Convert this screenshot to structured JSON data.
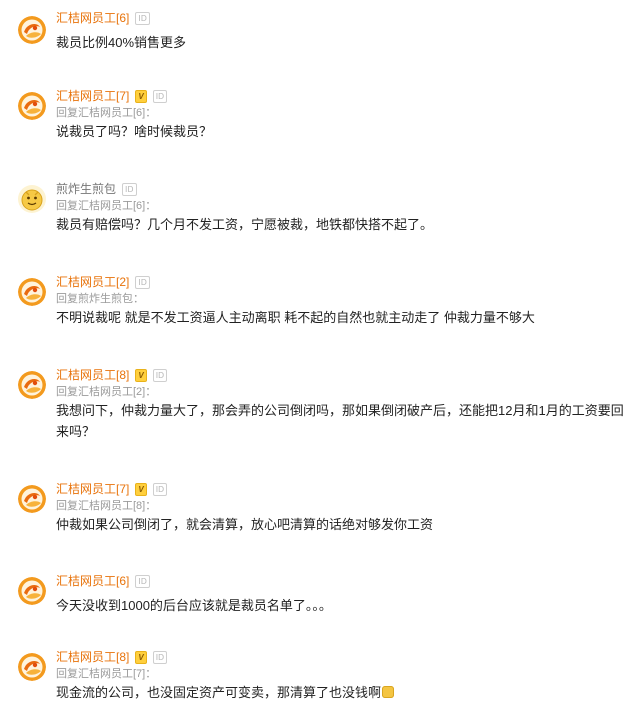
{
  "comments": [
    {
      "username": "汇桔网员工[6]",
      "badge_v": false,
      "badge_id": "ID",
      "reply_to": "",
      "text": "裁员比例40%销售更多",
      "avatar": "orange-logo-avatar"
    },
    {
      "username": "汇桔网员工[7]",
      "badge_v": true,
      "badge_v_label": "V",
      "badge_id": "ID",
      "reply_to": "回复汇桔网员工[6]：",
      "text": "说裁员了吗？啥时候裁员？",
      "avatar": "orange-logo-avatar"
    },
    {
      "username": "煎炸生煎包",
      "badge_v": false,
      "badge_id": "ID",
      "reply_to": "回复汇桔网员工[6]：",
      "text": "裁员有赔偿吗？几个月不发工资，宁愿被裁，地铁都快搭不起了。",
      "avatar": "cartoon-face-avatar"
    },
    {
      "username": "汇桔网员工[2]",
      "badge_v": false,
      "badge_id": "ID",
      "reply_to": "回复煎炸生煎包：",
      "text": "不明说裁呢 就是不发工资逼人主动离职 耗不起的自然也就主动走了 仲裁力量不够大",
      "avatar": "orange-logo-avatar"
    },
    {
      "username": "汇桔网员工[8]",
      "badge_v": true,
      "badge_v_label": "V",
      "badge_id": "ID",
      "reply_to": "回复汇桔网员工[2]：",
      "text": "我想问下，仲裁力量大了，那会弄的公司倒闭吗，那如果倒闭破产后，还能把12月和1月的工资要回来吗？",
      "avatar": "orange-logo-avatar"
    },
    {
      "username": "汇桔网员工[7]",
      "badge_v": true,
      "badge_v_label": "V",
      "badge_id": "ID",
      "reply_to": "回复汇桔网员工[8]：",
      "text": "仲裁如果公司倒闭了，就会清算，放心吧清算的话绝对够发你工资",
      "avatar": "orange-logo-avatar"
    },
    {
      "username": "汇桔网员工[6]",
      "badge_v": false,
      "badge_id": "ID",
      "reply_to": "",
      "text": "今天没收到1000的后台应该就是裁员名单了。。。",
      "avatar": "orange-logo-avatar"
    },
    {
      "username": "汇桔网员工[8]",
      "badge_v": true,
      "badge_v_label": "V",
      "badge_id": "ID",
      "reply_to": "回复汇桔网员工[7]：",
      "text": "现金流的公司，也没固定资产可变卖，那清算了也没钱啊",
      "emoji": "laughing-emoji-icon",
      "avatar": "orange-logo-avatar"
    }
  ],
  "colors": {
    "username": "#e8730b",
    "username_grey": "#777777",
    "reply_ref": "#9a9a9a",
    "text": "#222222"
  }
}
